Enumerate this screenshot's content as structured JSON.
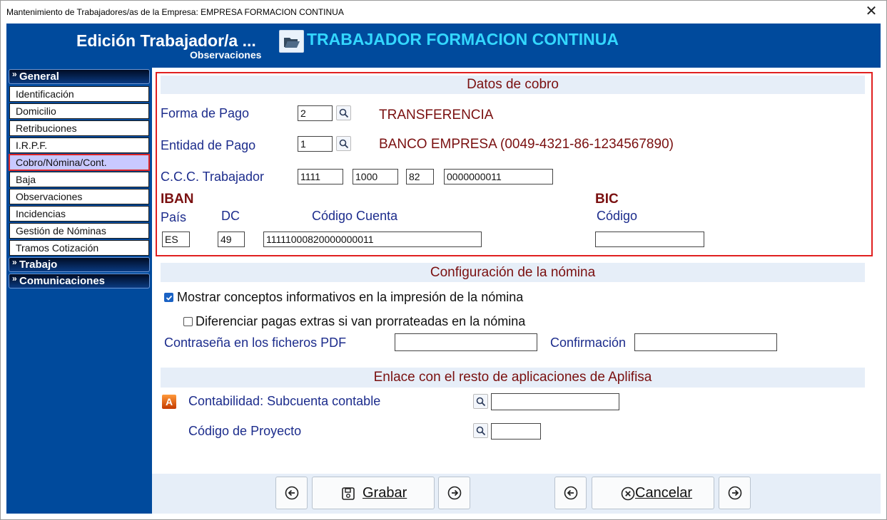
{
  "window": {
    "title": "Mantenimiento de Trabajadores/as de la Empresa: EMPRESA FORMACION CONTINUA",
    "close_symbol": "✕"
  },
  "header": {
    "title": "Edición Trabajador/a ...",
    "subtitle": "Observaciones",
    "worker_name": "TRABAJADOR FORMACION CONTINUA",
    "icon": "open-folder-icon"
  },
  "sidebar": {
    "groups": [
      {
        "label": "General",
        "chev": "»"
      },
      {
        "label": "Trabajo",
        "chev": "»"
      },
      {
        "label": "Comunicaciones",
        "chev": "»"
      }
    ],
    "items": [
      "Identificación",
      "Domicilio",
      "Retribuciones",
      "I.R.P.F.",
      "Cobro/Nómina/Cont.",
      "Baja",
      "Observaciones",
      "Incidencias",
      "Gestión de Nóminas",
      "Tramos Cotización"
    ],
    "active_item": "Cobro/Nómina/Cont."
  },
  "cobro": {
    "heading": "Datos de cobro",
    "forma_pago": {
      "label": "Forma de Pago",
      "value": "2",
      "description": "TRANSFERENCIA"
    },
    "entidad_pago": {
      "label": "Entidad de Pago",
      "value": "1",
      "description": "BANCO EMPRESA (0049-4321-86-1234567890)"
    },
    "ccc": {
      "label": "C.C.C. Trabajador",
      "entidad": "1111",
      "oficina": "1000",
      "dc": "82",
      "cuenta": "0000000011"
    },
    "iban": {
      "title": "IBAN",
      "pais_label": "País",
      "dc_label": "DC",
      "cuenta_label": "Código Cuenta",
      "pais": "ES",
      "dc": "49",
      "cuenta": "11111000820000000011"
    },
    "bic": {
      "title": "BIC",
      "codigo_label": "Código",
      "codigo": ""
    }
  },
  "nomina": {
    "heading": "Configuración de la nómina",
    "check1": {
      "label": "Mostrar conceptos informativos en la impresión de la nómina",
      "checked": true
    },
    "check2": {
      "label": "Diferenciar pagas extras si van prorrateadas en la nómina",
      "checked": false
    },
    "password_label": "Contraseña en los ficheros PDF",
    "password_value": "",
    "confirm_label": "Confirmación",
    "confirm_value": ""
  },
  "enlace": {
    "heading": "Enlace con el resto de aplicaciones de Aplifisa",
    "app_icon_letter": "A",
    "contabilidad_label": "Contabilidad: Subcuenta contable",
    "contabilidad_value": "",
    "proyecto_label": "Código de Proyecto",
    "proyecto_value": ""
  },
  "footer": {
    "save_label": "Grabar",
    "cancel_label": "Cancelar"
  },
  "colors": {
    "header_blue": "#004a9c",
    "accent_cyan": "#33d7ff",
    "dark_red": "#7a1010",
    "label_blue": "#1c2c8c",
    "highlight_red": "#e02020"
  }
}
